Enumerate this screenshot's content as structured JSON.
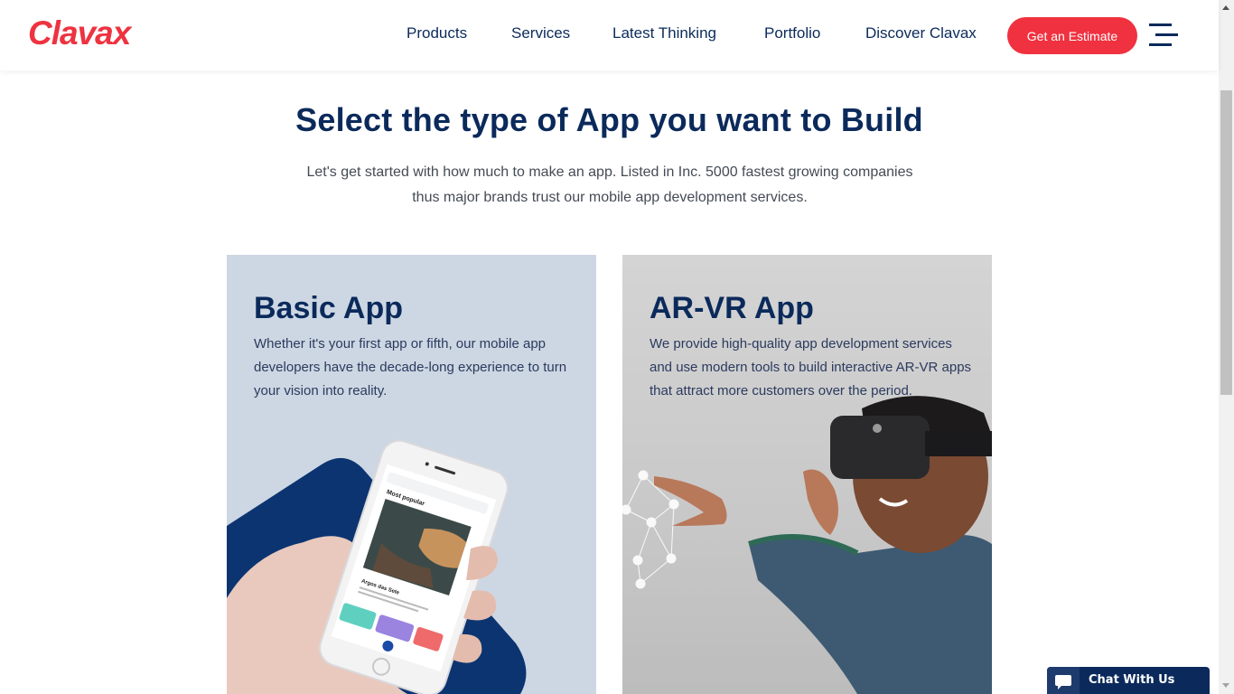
{
  "header": {
    "logo": "Clavax",
    "nav": [
      {
        "label": "Products"
      },
      {
        "label": "Services"
      },
      {
        "label": "Latest Thinking"
      },
      {
        "label": "Portfolio"
      },
      {
        "label": "Discover Clavax"
      }
    ],
    "cta_label": "Get an Estimate",
    "menu_icon": "hamburger-menu-icon"
  },
  "main": {
    "title": "Select the type of App you want to Build",
    "subtitle_line1": "Let's get started with how much to make an app. Listed in Inc. 5000 fastest growing companies",
    "subtitle_line2": "thus major brands trust our mobile app development services.",
    "cards": [
      {
        "title": "Basic App",
        "description": "Whether it's your first app or fifth, our mobile app developers have the decade-long experience to turn your vision into reality.",
        "image": "hand-holding-smartphone",
        "phone_screen": {
          "section": "Most popular",
          "card_title": "Argos das Sete"
        }
      },
      {
        "title": "AR-VR App",
        "description": "We provide high-quality app development services and use modern tools to build interactive AR-VR apps that attract more customers over the period.",
        "image": "man-wearing-vr-headset"
      }
    ]
  },
  "chat": {
    "label": "Chat With Us",
    "icon": "chat-bubble-icon"
  },
  "colors": {
    "brand_red": "#f0313f",
    "navy": "#0b2a5b",
    "basic_card_bg": "#cdd7e3",
    "arvr_card_bg": "#cccccc"
  }
}
